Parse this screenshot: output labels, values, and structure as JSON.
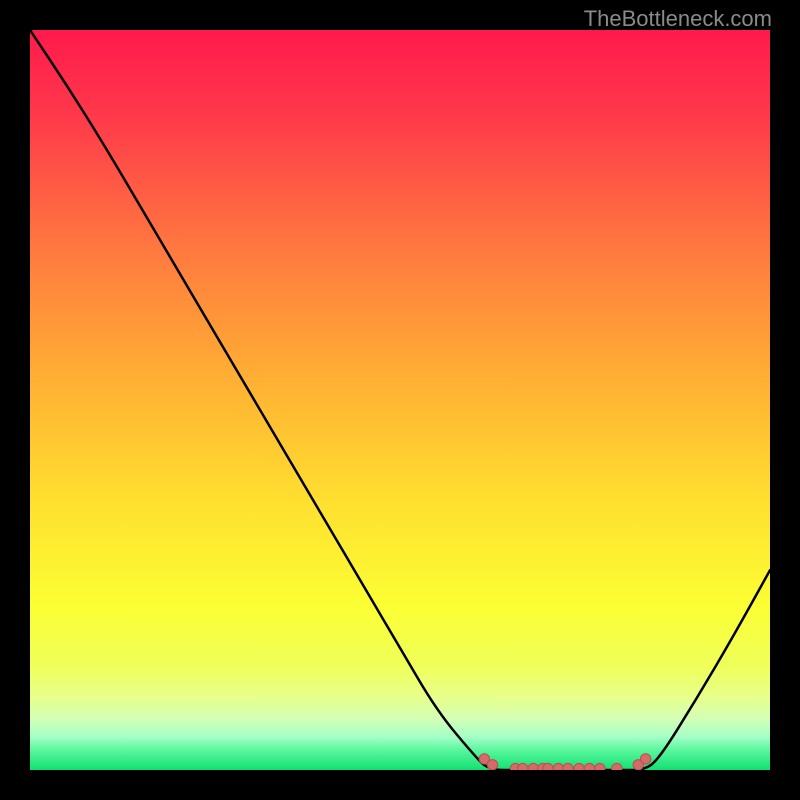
{
  "watermark": "TheBottleneck.com",
  "colors": {
    "bg": "#000000",
    "gradient_stops": [
      {
        "offset": 0.0,
        "color": "#ff1a4d"
      },
      {
        "offset": 0.12,
        "color": "#ff3a4a"
      },
      {
        "offset": 0.3,
        "color": "#ff7a3f"
      },
      {
        "offset": 0.48,
        "color": "#ffb233"
      },
      {
        "offset": 0.64,
        "color": "#ffe02f"
      },
      {
        "offset": 0.78,
        "color": "#fbff33"
      },
      {
        "offset": 0.86,
        "color": "#efff5a"
      },
      {
        "offset": 0.9,
        "color": "#e8ff8a"
      },
      {
        "offset": 0.93,
        "color": "#d4ffb4"
      },
      {
        "offset": 0.955,
        "color": "#a5ffc7"
      },
      {
        "offset": 0.975,
        "color": "#54f59a"
      },
      {
        "offset": 1.0,
        "color": "#12e072"
      }
    ],
    "curve": "#000000",
    "marker_fill": "#d46a6a",
    "marker_stroke": "#b94e4e"
  },
  "chart_data": {
    "type": "line",
    "title": "",
    "xlabel": "",
    "ylabel": "",
    "x": [
      0.0,
      0.05,
      0.1,
      0.15,
      0.2,
      0.25,
      0.3,
      0.35,
      0.4,
      0.45,
      0.5,
      0.55,
      0.6,
      0.62,
      0.66,
      0.7,
      0.75,
      0.8,
      0.83,
      0.85,
      0.9,
      0.95,
      1.0
    ],
    "values": [
      1.0,
      0.925,
      0.845,
      0.76,
      0.675,
      0.59,
      0.505,
      0.42,
      0.335,
      0.25,
      0.165,
      0.08,
      0.02,
      0.0,
      0.0,
      0.0,
      0.0,
      0.0,
      0.0,
      0.015,
      0.095,
      0.18,
      0.27
    ],
    "ylim": [
      0,
      1
    ],
    "xlim": [
      0,
      1
    ],
    "markers": [
      {
        "x": 0.614,
        "y": 0.015
      },
      {
        "x": 0.625,
        "y": 0.007
      },
      {
        "x": 0.656,
        "y": 0.002
      },
      {
        "x": 0.666,
        "y": 0.002
      },
      {
        "x": 0.68,
        "y": 0.002
      },
      {
        "x": 0.693,
        "y": 0.002
      },
      {
        "x": 0.7,
        "y": 0.002
      },
      {
        "x": 0.714,
        "y": 0.002
      },
      {
        "x": 0.727,
        "y": 0.002
      },
      {
        "x": 0.742,
        "y": 0.002
      },
      {
        "x": 0.756,
        "y": 0.002
      },
      {
        "x": 0.77,
        "y": 0.002
      },
      {
        "x": 0.793,
        "y": 0.002
      },
      {
        "x": 0.822,
        "y": 0.007
      },
      {
        "x": 0.832,
        "y": 0.015
      }
    ]
  }
}
